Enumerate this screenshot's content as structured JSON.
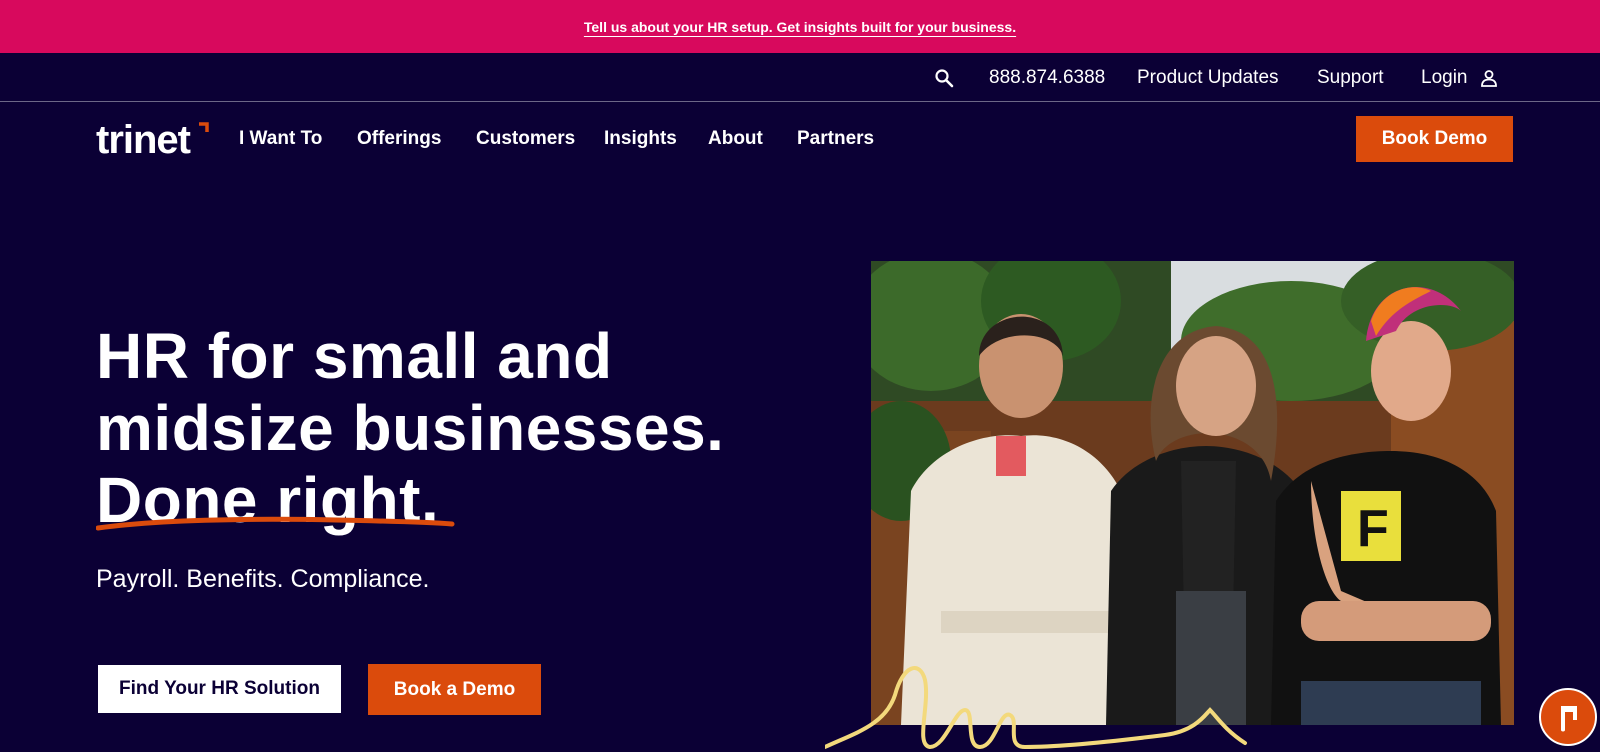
{
  "announcement": {
    "text": "Tell us about your HR setup. Get insights built for your business."
  },
  "utility": {
    "search_icon": "search-icon",
    "phone": "888.874.6388",
    "product_updates": "Product Updates",
    "support": "Support",
    "login": "Login",
    "login_icon": "user-icon"
  },
  "nav": {
    "logo_text": "trinet",
    "items": [
      {
        "label": "I Want To"
      },
      {
        "label": "Offerings"
      },
      {
        "label": "Customers"
      },
      {
        "label": "Insights"
      },
      {
        "label": "About"
      },
      {
        "label": "Partners"
      }
    ],
    "cta": "Book Demo"
  },
  "hero": {
    "title_line1": "HR for small and",
    "title_line2": "midsize businesses.",
    "title_line3": "Done right.",
    "subtitle": "Payroll. Benefits. Compliance.",
    "primary_button": "Find Your HR Solution",
    "secondary_button": "Book a Demo"
  },
  "colors": {
    "announcement_bg": "#d8095d",
    "page_bg": "#0b0035",
    "accent_orange": "#db4b0c",
    "squiggle_yellow": "#f3d97c"
  }
}
